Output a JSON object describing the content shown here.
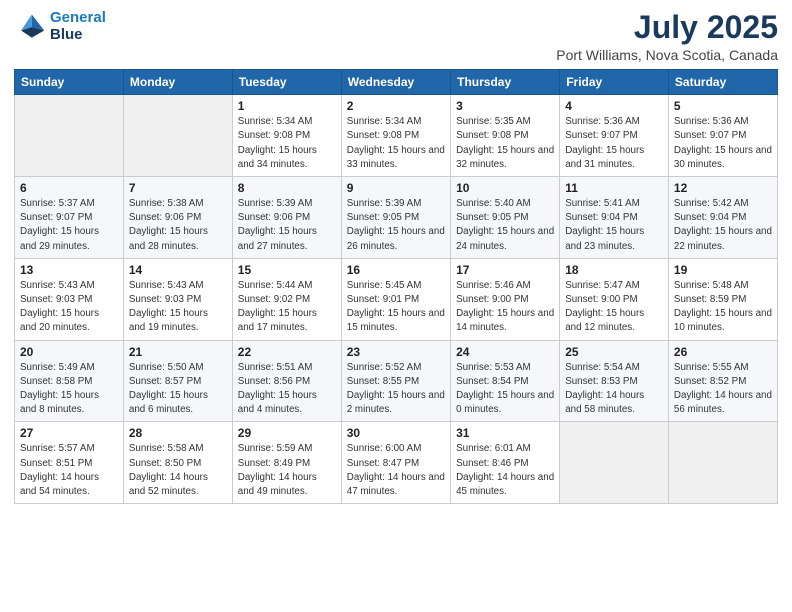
{
  "header": {
    "logo_line1": "General",
    "logo_line2": "Blue",
    "title": "July 2025",
    "subtitle": "Port Williams, Nova Scotia, Canada"
  },
  "weekdays": [
    "Sunday",
    "Monday",
    "Tuesday",
    "Wednesday",
    "Thursday",
    "Friday",
    "Saturday"
  ],
  "weeks": [
    [
      {
        "day": "",
        "info": ""
      },
      {
        "day": "",
        "info": ""
      },
      {
        "day": "1",
        "info": "Sunrise: 5:34 AM\nSunset: 9:08 PM\nDaylight: 15 hours and 34 minutes."
      },
      {
        "day": "2",
        "info": "Sunrise: 5:34 AM\nSunset: 9:08 PM\nDaylight: 15 hours and 33 minutes."
      },
      {
        "day": "3",
        "info": "Sunrise: 5:35 AM\nSunset: 9:08 PM\nDaylight: 15 hours and 32 minutes."
      },
      {
        "day": "4",
        "info": "Sunrise: 5:36 AM\nSunset: 9:07 PM\nDaylight: 15 hours and 31 minutes."
      },
      {
        "day": "5",
        "info": "Sunrise: 5:36 AM\nSunset: 9:07 PM\nDaylight: 15 hours and 30 minutes."
      }
    ],
    [
      {
        "day": "6",
        "info": "Sunrise: 5:37 AM\nSunset: 9:07 PM\nDaylight: 15 hours and 29 minutes."
      },
      {
        "day": "7",
        "info": "Sunrise: 5:38 AM\nSunset: 9:06 PM\nDaylight: 15 hours and 28 minutes."
      },
      {
        "day": "8",
        "info": "Sunrise: 5:39 AM\nSunset: 9:06 PM\nDaylight: 15 hours and 27 minutes."
      },
      {
        "day": "9",
        "info": "Sunrise: 5:39 AM\nSunset: 9:05 PM\nDaylight: 15 hours and 26 minutes."
      },
      {
        "day": "10",
        "info": "Sunrise: 5:40 AM\nSunset: 9:05 PM\nDaylight: 15 hours and 24 minutes."
      },
      {
        "day": "11",
        "info": "Sunrise: 5:41 AM\nSunset: 9:04 PM\nDaylight: 15 hours and 23 minutes."
      },
      {
        "day": "12",
        "info": "Sunrise: 5:42 AM\nSunset: 9:04 PM\nDaylight: 15 hours and 22 minutes."
      }
    ],
    [
      {
        "day": "13",
        "info": "Sunrise: 5:43 AM\nSunset: 9:03 PM\nDaylight: 15 hours and 20 minutes."
      },
      {
        "day": "14",
        "info": "Sunrise: 5:43 AM\nSunset: 9:03 PM\nDaylight: 15 hours and 19 minutes."
      },
      {
        "day": "15",
        "info": "Sunrise: 5:44 AM\nSunset: 9:02 PM\nDaylight: 15 hours and 17 minutes."
      },
      {
        "day": "16",
        "info": "Sunrise: 5:45 AM\nSunset: 9:01 PM\nDaylight: 15 hours and 15 minutes."
      },
      {
        "day": "17",
        "info": "Sunrise: 5:46 AM\nSunset: 9:00 PM\nDaylight: 15 hours and 14 minutes."
      },
      {
        "day": "18",
        "info": "Sunrise: 5:47 AM\nSunset: 9:00 PM\nDaylight: 15 hours and 12 minutes."
      },
      {
        "day": "19",
        "info": "Sunrise: 5:48 AM\nSunset: 8:59 PM\nDaylight: 15 hours and 10 minutes."
      }
    ],
    [
      {
        "day": "20",
        "info": "Sunrise: 5:49 AM\nSunset: 8:58 PM\nDaylight: 15 hours and 8 minutes."
      },
      {
        "day": "21",
        "info": "Sunrise: 5:50 AM\nSunset: 8:57 PM\nDaylight: 15 hours and 6 minutes."
      },
      {
        "day": "22",
        "info": "Sunrise: 5:51 AM\nSunset: 8:56 PM\nDaylight: 15 hours and 4 minutes."
      },
      {
        "day": "23",
        "info": "Sunrise: 5:52 AM\nSunset: 8:55 PM\nDaylight: 15 hours and 2 minutes."
      },
      {
        "day": "24",
        "info": "Sunrise: 5:53 AM\nSunset: 8:54 PM\nDaylight: 15 hours and 0 minutes."
      },
      {
        "day": "25",
        "info": "Sunrise: 5:54 AM\nSunset: 8:53 PM\nDaylight: 14 hours and 58 minutes."
      },
      {
        "day": "26",
        "info": "Sunrise: 5:55 AM\nSunset: 8:52 PM\nDaylight: 14 hours and 56 minutes."
      }
    ],
    [
      {
        "day": "27",
        "info": "Sunrise: 5:57 AM\nSunset: 8:51 PM\nDaylight: 14 hours and 54 minutes."
      },
      {
        "day": "28",
        "info": "Sunrise: 5:58 AM\nSunset: 8:50 PM\nDaylight: 14 hours and 52 minutes."
      },
      {
        "day": "29",
        "info": "Sunrise: 5:59 AM\nSunset: 8:49 PM\nDaylight: 14 hours and 49 minutes."
      },
      {
        "day": "30",
        "info": "Sunrise: 6:00 AM\nSunset: 8:47 PM\nDaylight: 14 hours and 47 minutes."
      },
      {
        "day": "31",
        "info": "Sunrise: 6:01 AM\nSunset: 8:46 PM\nDaylight: 14 hours and 45 minutes."
      },
      {
        "day": "",
        "info": ""
      },
      {
        "day": "",
        "info": ""
      }
    ]
  ]
}
